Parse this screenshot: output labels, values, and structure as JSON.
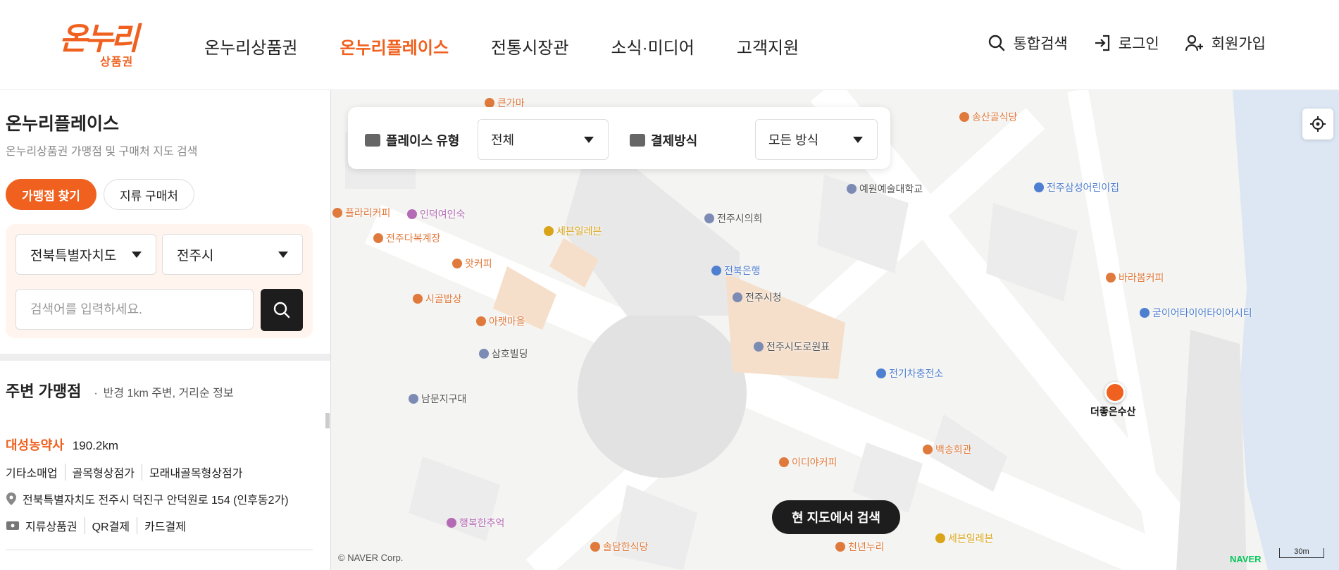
{
  "header": {
    "logo_main": "온누리",
    "logo_sub": "상품권",
    "nav": [
      {
        "label": "온누리상품권"
      },
      {
        "label": "온누리플레이스"
      },
      {
        "label": "전통시장관"
      },
      {
        "label": "소식·미디어"
      },
      {
        "label": "고객지원"
      }
    ],
    "active_nav": "온누리플레이스",
    "util": {
      "search": "통합검색",
      "login": "로그인",
      "signup": "회원가입"
    }
  },
  "sidebar": {
    "title": "온누리플레이스",
    "description": "온누리상품권 가맹점 및 구매처 지도 검색",
    "tabs": [
      {
        "label": "가맹점 찾기",
        "active": true
      },
      {
        "label": "지류 구매처",
        "active": false
      }
    ],
    "region": "전북특별자치도",
    "city": "전주시",
    "search_placeholder": "검색어를 입력하세요.",
    "nearby": {
      "title": "주변 가맹점",
      "desc": "반경 1km 주변, 거리순 정보",
      "stores": [
        {
          "name": "대성농약사",
          "distance": "190.2km",
          "categories": [
            "기타소매업",
            "골목형상점가",
            "모래내골목형상점가"
          ],
          "address": "전북특별자치도 전주시 덕진구 안덕원로 154 (인후동2가)",
          "payments": [
            "지류상품권",
            "QR결제",
            "카드결제"
          ]
        }
      ]
    }
  },
  "map": {
    "filter": {
      "place_type_label": "플레이스 유형",
      "place_type_value": "전체",
      "payment_label": "결제방식",
      "payment_value": "모든 방식"
    },
    "current_search_btn": "현 지도에서 검색",
    "marker_label": "더좋은수산",
    "copyright": "© NAVER Corp.",
    "naver_logo": "NAVER",
    "scale": "30m",
    "pois": [
      {
        "name": "큰가마",
        "color": "#e07a3c"
      },
      {
        "name": "송산골식당",
        "color": "#e07a3c"
      },
      {
        "name": "인덕여인숙",
        "color": "#b46ab4"
      },
      {
        "name": "플라리커피",
        "color": "#e07a3c"
      },
      {
        "name": "전주다복계장",
        "color": "#e07a3c"
      },
      {
        "name": "세븐일레븐",
        "color": "#d9a418"
      },
      {
        "name": "전주시의회",
        "color": "#7c8bb4"
      },
      {
        "name": "예원예술대학교",
        "color": "#7c8bb4"
      },
      {
        "name": "전주삼성어린이집",
        "color": "#4f7fd0"
      },
      {
        "name": "왓커피",
        "color": "#e07a3c"
      },
      {
        "name": "전북은행",
        "color": "#4f7fd0"
      },
      {
        "name": "전주시청",
        "color": "#7c8bb4"
      },
      {
        "name": "바라봄커피",
        "color": "#e07a3c"
      },
      {
        "name": "시골밥상",
        "color": "#e07a3c"
      },
      {
        "name": "아랫마을",
        "color": "#e07a3c"
      },
      {
        "name": "굳이어타이어타이어시티",
        "color": "#4f7fd0"
      },
      {
        "name": "전주시도로원표",
        "color": "#7c8bb4"
      },
      {
        "name": "삼호빌딩",
        "color": "#7c8bb4"
      },
      {
        "name": "전기차충전소",
        "color": "#4f7fd0"
      },
      {
        "name": "남문지구대",
        "color": "#7c8bb4"
      },
      {
        "name": "백송회관",
        "color": "#e07a3c"
      },
      {
        "name": "이디야커피",
        "color": "#e07a3c"
      },
      {
        "name": "행복한추억",
        "color": "#b46ab4"
      },
      {
        "name": "솔담한식당",
        "color": "#e07a3c"
      },
      {
        "name": "천년누리",
        "color": "#e07a3c"
      },
      {
        "name": "세븐일레븐",
        "color": "#d9a418"
      }
    ]
  },
  "colors": {
    "accent": "#f0601e",
    "dark": "#1d1d1d"
  }
}
